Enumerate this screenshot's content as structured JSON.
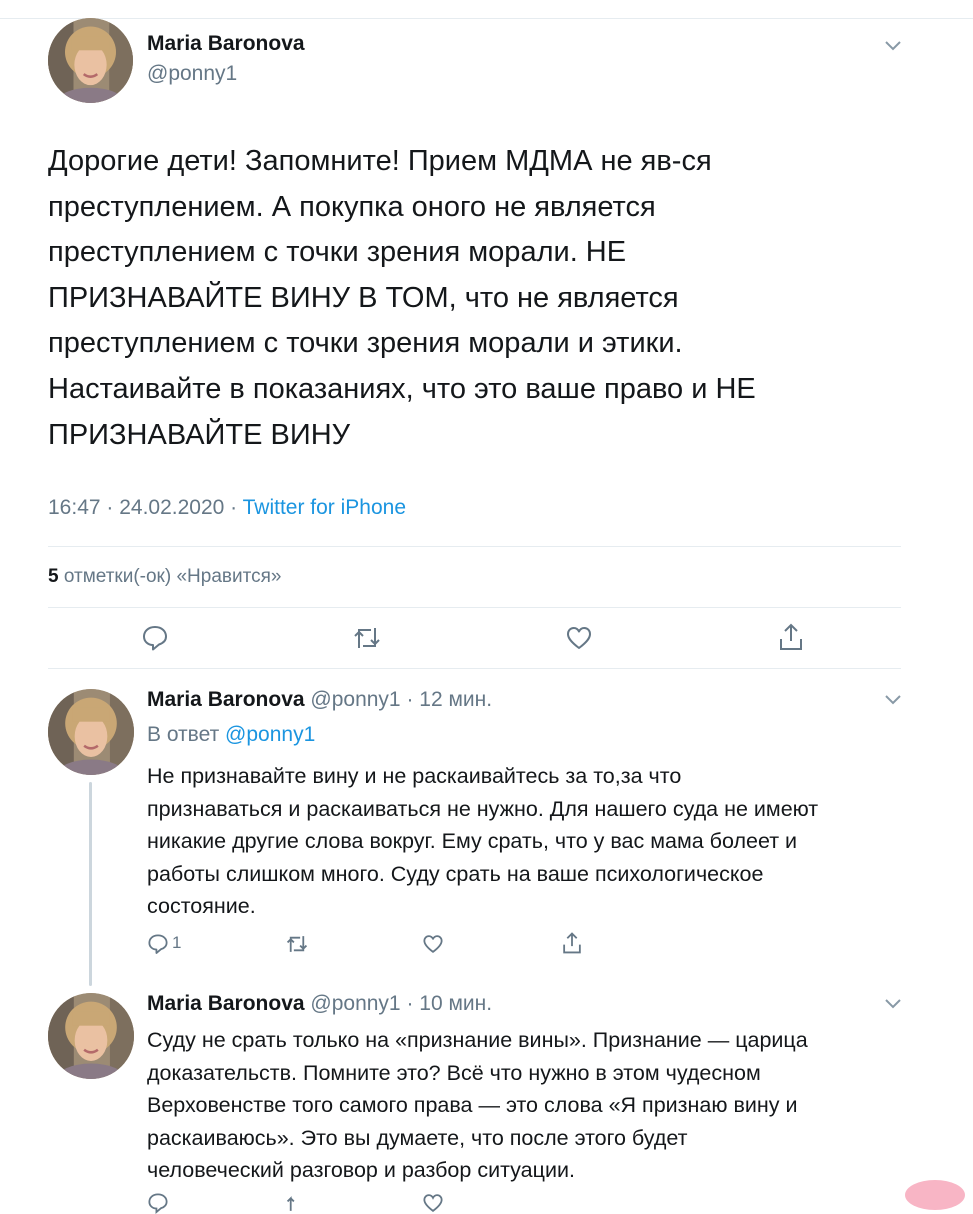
{
  "main_tweet": {
    "author_name": "Maria Baronova",
    "author_handle": "@ponny1",
    "text_lines": [
      "Дорогие дети! Запомните! Прием МДМА не яв-ся",
      "преступлением. А покупка оного не является",
      "преступлением с точки зрения морали. НЕ",
      "ПРИЗНАВАЙТЕ ВИНУ В ТОМ, что не является",
      "преступлением с точки зрения морали и этики.",
      "Настаивайте в показаниях, что это ваше право и НЕ",
      "ПРИЗНАВАЙТЕ ВИНУ"
    ],
    "timestamp": "16:47 · 24.02.2020 · ",
    "source": "Twitter for iPhone",
    "likes_count": "5",
    "likes_label": " отметки(-ок) «Нравится»"
  },
  "replies": [
    {
      "author_name": "Maria Baronova",
      "meta": " @ponny1 · 12 мин.",
      "in_reply_prefix": "В ответ ",
      "in_reply_handle": "@ponny1",
      "text_lines": [
        "Не признавайте вину и не раскаивайтесь за то,за что",
        "признаваться и раскаиваться не нужно. Для нашего суда не имеют",
        "никакие другие слова вокруг. Ему срать, что у вас мама болеет и",
        "работы слишком много. Суду срать на ваше психологическое",
        "состояние."
      ],
      "reply_count": "1"
    },
    {
      "author_name": "Maria Baronova",
      "meta": " @ponny1 · 10 мин.",
      "text_lines": [
        "Суду не срать только на «признание вины». Признание — царица",
        "доказательств. Помните это? Всё что нужно в этом чудесном",
        "Верховенстве того самого права — это слова «Я признаю вину и",
        "раскаиваюсь». Это вы думаете, что после этого будет",
        "человеческий разговор и разбор ситуации."
      ]
    }
  ],
  "colors": {
    "text": "#14171a",
    "muted": "#657786",
    "link": "#1b95e0",
    "divider": "#e6ecf0"
  },
  "icons": [
    "chevron-down-icon",
    "reply-icon",
    "retweet-icon",
    "like-icon",
    "share-icon"
  ]
}
